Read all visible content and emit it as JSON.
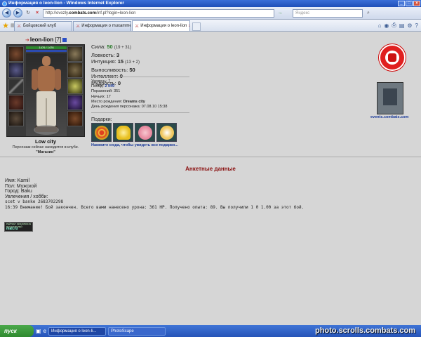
{
  "window": {
    "title": "Информация о leon-lion - Windows Internet Explorer"
  },
  "address": {
    "prefix": "http://ovozly.",
    "host": "combats.com",
    "path": "/inf.pl?login=leon-lion",
    "search_placeholder": "Яндекс"
  },
  "tabs": [
    {
      "label": "Бойцовский клуб"
    },
    {
      "label": "Информация о muxammed"
    },
    {
      "label": "Информация о leon-lion"
    }
  ],
  "character": {
    "name": "leon-lion",
    "level": "[7]",
    "hp_text": "1476 / 1476",
    "city": "Low city",
    "location_note": "Персонаж сейчас находится в клубе.",
    "location_place": "\"Магазин\""
  },
  "stats": [
    {
      "label": "Сила:",
      "value": "50",
      "bonus": "(19 + 31)",
      "green": true
    },
    {
      "label": "Ловкость:",
      "value": "3",
      "bonus": "",
      "green": false
    },
    {
      "label": "Интуиция:",
      "value": "15",
      "bonus": "(13 + 2)",
      "green": false
    },
    {
      "label": "Выносливость:",
      "value": "50",
      "bonus": "",
      "green": false
    },
    {
      "label": "Интеллект:",
      "value": "0",
      "bonus": "",
      "green": false
    },
    {
      "label": "Мудрость:",
      "value": "0",
      "bonus": "",
      "green": false
    }
  ],
  "info": {
    "level_label": "Уровень:",
    "level_value": "7",
    "wins_label": "Побед:",
    "wins_value": "2 949",
    "losses_label": "Поражений:",
    "losses_value": "351",
    "draws_label": "Ничьих:",
    "draws_value": "17",
    "birthplace_label": "Место рождения:",
    "birthplace_value": "Dreams city",
    "birthday_label": "День рождения персонажа:",
    "birthday_value": "07.08.10 15:38"
  },
  "gifts": {
    "title": "Подарки:",
    "link": "Нажмите сюда, чтобы увидеть все подарки...",
    "items": [
      {
        "icon": "target-gift-icon",
        "color": "#d6a020"
      },
      {
        "icon": "bell-gift-icon",
        "color": "#e8c020"
      },
      {
        "icon": "doll-gift-icon",
        "color": "#e88aa0"
      },
      {
        "icon": "cup-gift-icon",
        "color": "#f0c860"
      }
    ]
  },
  "sidebar": {
    "events_link": "events.combats.com"
  },
  "anketa": {
    "title": "Анкетные данные",
    "name_line": "Имя: Kamil",
    "gender_line": "Пол: Мужской",
    "city_line": "Город: Baku",
    "hobby_line": "Увлечения / хобби:",
    "hobby_value": "scet v banke 2683702298",
    "battle_log": "16:39 Внимание! Бой закончен. Всего вами нанесено урона: 361 HP. Получено опыта: 89. Вы получили 1 0 1.00 за этот бой."
  },
  "counter": {
    "left": "РЕЙТИНГ 299429 ПОСЕТИТЕЛЕЙ",
    "right": "500139 ",
    "logo": "mail.ru"
  },
  "taskbar": {
    "start": "пуск",
    "items": [
      "Информация о leon-li...",
      "PhotoScape"
    ]
  },
  "watermark": "photo.scrolls.combats.com",
  "colors": {
    "anketa_title": "#8a1010",
    "link_blue": "#1a3a9a",
    "stat_green": "#2a7a2a"
  }
}
